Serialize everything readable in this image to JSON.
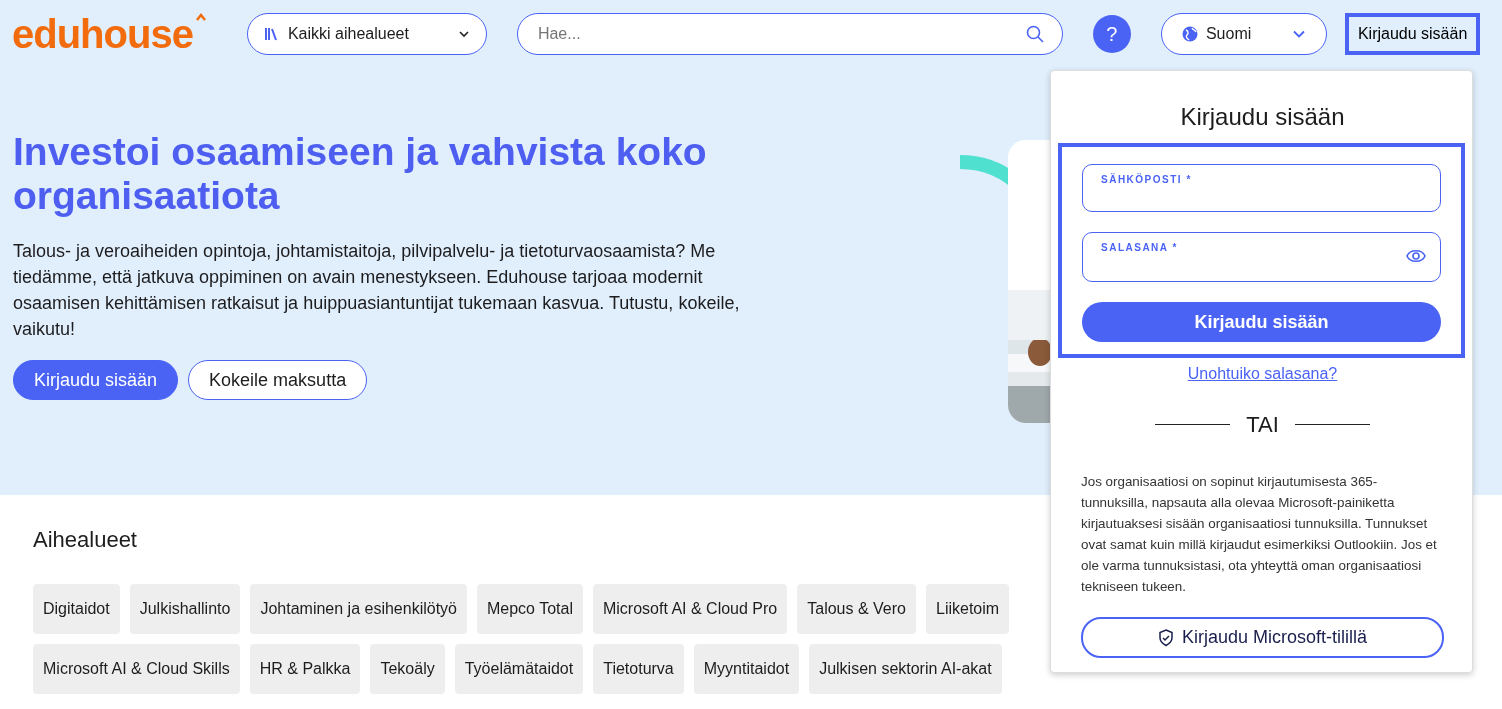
{
  "header": {
    "logo": "eduhouse",
    "category_select": {
      "value": "Kaikki aihealueet"
    },
    "search": {
      "placeholder": "Hae..."
    },
    "help": "?",
    "language": {
      "value": "Suomi"
    },
    "login_button": {
      "label": "Kirjaudu sisään",
      "selected": true
    }
  },
  "hero": {
    "title": "Investoi osaamiseen ja vahvista koko organisaatiota",
    "text": "Talous- ja veroaiheiden opintoja, johtamistaitoja, pilvipalvelu- ja tietoturvaosaamista? Me tiedämme, että jatkuva oppiminen on avain menestykseen. Eduhouse tarjoaa modernit osaamisen kehittämisen ratkaisut ja huippuasiantuntijat tukemaan kasvua. Tutustu, kokeile, vaikutu!",
    "buttons": [
      {
        "label": "Kirjaudu sisään",
        "kind": "primary"
      },
      {
        "label": "Kokeile maksutta",
        "kind": "outline"
      }
    ]
  },
  "topics": {
    "title": "Aihealueet",
    "tag_lines": [
      {
        "tags": [
          "Digitaidot",
          "Julkishallinto",
          "Johtaminen ja esihenkilötyö",
          "Mepco Total",
          "Microsoft AI & Cloud Pro",
          "Talous & Vero",
          "Liiketoim"
        ]
      },
      {
        "tags": [
          "Microsoft AI & Cloud Skills",
          "HR & Palkka",
          "Tekoäly",
          "Työelämätaidot",
          "Tietoturva",
          "Myyntitaidot",
          "Julkisen sektorin AI-akat"
        ]
      }
    ]
  },
  "login_dropdown": {
    "title": "Kirjaudu sisään",
    "fields": [
      {
        "label": "SÄHKÖPOSTI *",
        "kind": "email"
      },
      {
        "label": "SALASANA *",
        "kind": "password"
      }
    ],
    "submit": "Kirjaudu sisään",
    "forgot_link": "Unohtuiko salasana?",
    "divider": "TAI",
    "info": "Jos organisaatiosi on sopinut kirjautumisesta 365-tunnuksilla, napsauta alla olevaa Microsoft-painiketta kirjautuaksesi sisään organisaatiosi tunnuksilla. Tunnukset ovat samat kuin millä kirjaudut esimerkiksi Outlookiin. Jos et ole varma tunnuksistasi, ota yhteyttä oman organisaatiosi tekniseen tukeen.",
    "microsoft_button": "Kirjaudu Microsoft-tilillä"
  }
}
